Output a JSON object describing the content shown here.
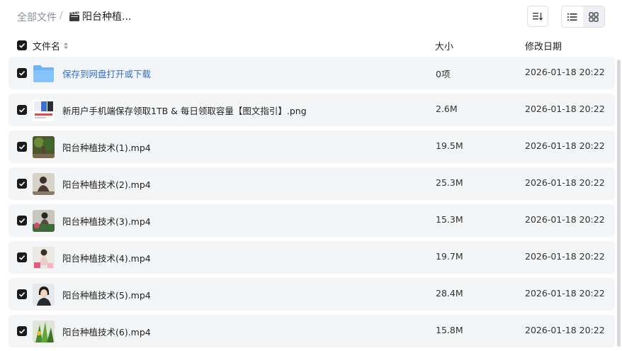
{
  "breadcrumb": {
    "root": "全部文件",
    "separator": "/",
    "current": "阳台种植..."
  },
  "columns": {
    "name": "文件名",
    "size": "大小",
    "date": "修改日期"
  },
  "files": [
    {
      "name": "保存到网盘打开或下载",
      "size": "0项",
      "date": "2026-01-18 20:22",
      "type": "folder"
    },
    {
      "name": "新用户手机端保存领取1TB & 每日领取容量【图文指引】.png",
      "size": "2.6M",
      "date": "2026-01-18 20:22",
      "type": "image"
    },
    {
      "name": "阳台种植技术(1).mp4",
      "size": "19.5M",
      "date": "2026-01-18 20:22",
      "type": "video"
    },
    {
      "name": "阳台种植技术(2).mp4",
      "size": "25.3M",
      "date": "2026-01-18 20:22",
      "type": "video"
    },
    {
      "name": "阳台种植技术(3).mp4",
      "size": "15.3M",
      "date": "2026-01-18 20:22",
      "type": "video"
    },
    {
      "name": "阳台种植技术(4).mp4",
      "size": "19.7M",
      "date": "2026-01-18 20:22",
      "type": "video"
    },
    {
      "name": "阳台种植技术(5).mp4",
      "size": "28.4M",
      "date": "2026-01-18 20:22",
      "type": "video"
    },
    {
      "name": "阳台种植技术(6).mp4",
      "size": "15.8M",
      "date": "2026-01-18 20:22",
      "type": "video"
    }
  ],
  "colors": {
    "accent_link": "#2f6fd3",
    "row_bg": "#f4f5f6",
    "folder": "#6fb3f5"
  }
}
